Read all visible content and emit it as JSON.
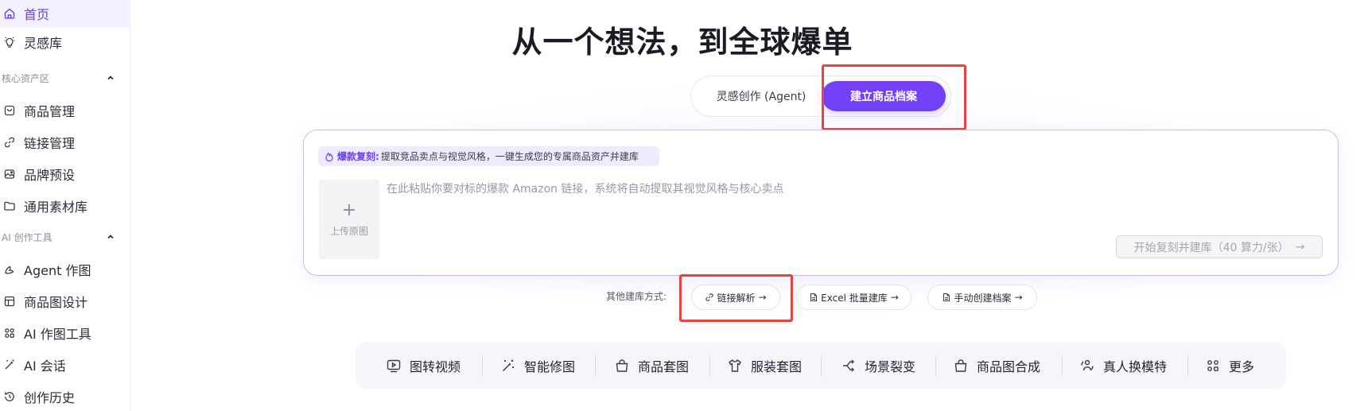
{
  "sidebar": {
    "items": [
      {
        "label": "首页",
        "icon": "home-icon",
        "active": true
      },
      {
        "label": "灵感库",
        "icon": "lightbulb-icon"
      },
      {
        "label": "商品管理",
        "icon": "bag-icon"
      },
      {
        "label": "链接管理",
        "icon": "link-icon"
      },
      {
        "label": "品牌预设",
        "icon": "palette-icon"
      },
      {
        "label": "通用素材库",
        "icon": "folder-icon"
      },
      {
        "label": "Agent 作图",
        "icon": "agent-icon"
      },
      {
        "label": "商品图设计",
        "icon": "layout-icon"
      },
      {
        "label": "AI 作图工具",
        "icon": "grid-icon"
      },
      {
        "label": "AI 会话",
        "icon": "wand-icon"
      },
      {
        "label": "创作历史",
        "icon": "history-icon"
      }
    ],
    "sections": [
      {
        "label": "核心资产区",
        "icon": "chevron-up-icon"
      },
      {
        "label": "AI 创作工具",
        "icon": "chevron-up-icon"
      }
    ]
  },
  "main": {
    "title": "从一个想法，到全球爆单",
    "mode_toggle": {
      "inactive_label": "灵感创作 (Agent)",
      "active_label": "建立商品档案"
    },
    "card": {
      "hint_key": "爆款复刻:",
      "hint_text": "提取竞品卖点与视觉风格，一键生成您的专属商品资产并建库",
      "hint_icon": "flame-icon",
      "upload_label": "上传原图",
      "input_placeholder": "在此粘贴你要对标的爆款 Amazon 链接，系统将自动提取其视觉风格与核心卖点",
      "input_value": "",
      "start_label": "开始复刻并建库（40 算力/张）"
    },
    "other_methods": {
      "label": "其他建库方式:",
      "buttons": [
        {
          "label": "链接解析",
          "icon": "link-icon"
        },
        {
          "label": "Excel 批量建库",
          "icon": "file-icon"
        },
        {
          "label": "手动创建档案",
          "icon": "file-icon"
        }
      ]
    },
    "tools": [
      {
        "label": "图转视频",
        "icon": "video-icon"
      },
      {
        "label": "智能修图",
        "icon": "magic-icon"
      },
      {
        "label": "商品套图",
        "icon": "bag-icon"
      },
      {
        "label": "服装套图",
        "icon": "shirt-icon"
      },
      {
        "label": "场景裂变",
        "icon": "split-icon"
      },
      {
        "label": "商品图合成",
        "icon": "bag-icon"
      },
      {
        "label": "真人换模特",
        "icon": "swap-icon"
      },
      {
        "label": "更多",
        "icon": "more-grid-icon"
      }
    ]
  },
  "colors": {
    "accent": "#7341f5",
    "annotation_red": "#e8433f",
    "card_border": "#c9b8fb"
  }
}
